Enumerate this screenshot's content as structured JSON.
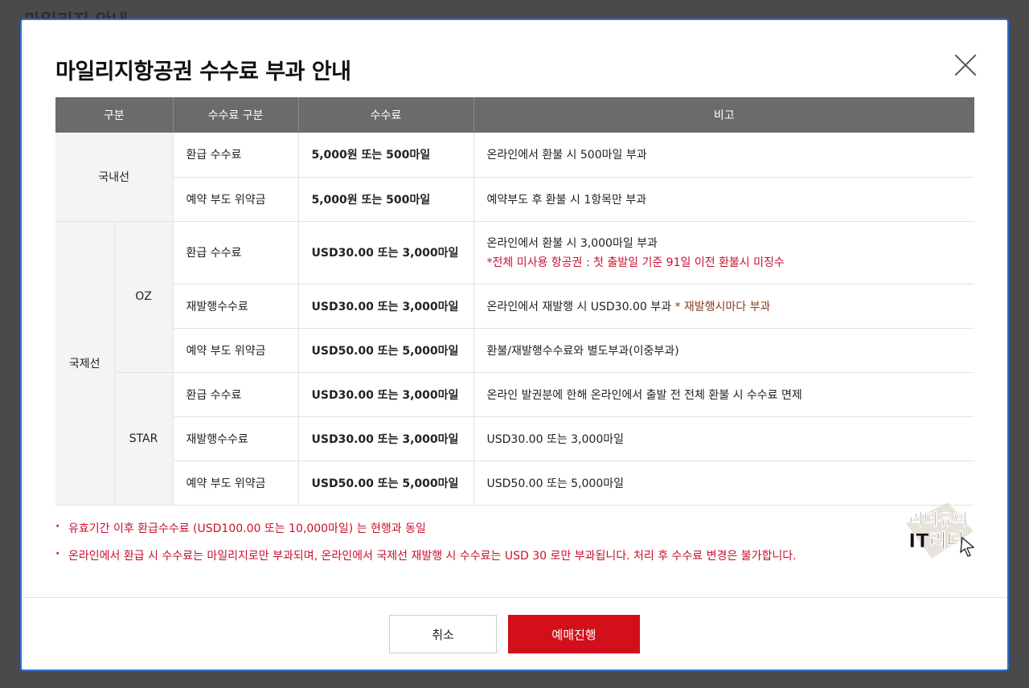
{
  "background": {
    "title": "마일리지 안내"
  },
  "modal": {
    "title": "마일리지항공권 수수료 부과 안내",
    "close_icon": "close-icon"
  },
  "table": {
    "headers": [
      "구분",
      "수수료 구분",
      "수수료",
      "비고"
    ],
    "domestic": {
      "label": "국내선",
      "rows": [
        {
          "type": "환급 수수료",
          "fee": "5,000원 또는 500마일",
          "note": "온라인에서 환불 시 500마일 부과"
        },
        {
          "type": "예약 부도 위약금",
          "fee": "5,000원 또는 500마일",
          "note": "예약부도 후 환불 시 1항목만 부과"
        }
      ]
    },
    "international": {
      "label": "국제선",
      "oz": {
        "label": "OZ",
        "rows": [
          {
            "type": "환급 수수료",
            "fee": "USD30.00 또는 3,000마일",
            "note": "온라인에서 환불 시 3,000마일 부과",
            "note_red": "*전체 미사용 항공권 : 첫 출발일 기준 91일 이전 환불시 미징수"
          },
          {
            "type": "재발행수수료",
            "fee": "USD30.00 또는 3,000마일",
            "note": "온라인에서 재발행 시 USD30.00 부과",
            "note_brown": "* 재발행시마다 부과"
          },
          {
            "type": "예약 부도 위약금",
            "fee": "USD50.00 또는 5,000마일",
            "note": "환불/재발행수수료와 별도부과(이중부과)"
          }
        ]
      },
      "star": {
        "label": "STAR",
        "rows": [
          {
            "type": "환급 수수료",
            "fee": "USD30.00 또는 3,000마일",
            "note": "온라인 발권분에 한해 온라인에서 출발 전 전체 환불 시 수수료 면제"
          },
          {
            "type": "재발행수수료",
            "fee": "USD30.00 또는 3,000마일",
            "note": "USD30.00 또는 3,000마일"
          },
          {
            "type": "예약 부도 위약금",
            "fee": "USD50.00 또는 5,000마일",
            "note": "USD50.00 또는 5,000마일"
          }
        ]
      }
    }
  },
  "notes": [
    "유효기간 이후 환급수수료 (USD100.00 또는 10,000마일) 는 현행과 동일",
    "온라인에서 환급 시 수수료는 마일리지로만 부과되며, 온라인에서 국제선 재발행 시 수수료는 USD 30 로만 부과됩니다. 처리 후 수수료 변경은 불가합니다."
  ],
  "watermark": {
    "line1": "리더유의",
    "line2": "IT리더"
  },
  "buttons": {
    "cancel": "취소",
    "proceed": "예매진행"
  },
  "colors": {
    "accent": "#d30f1b",
    "header_bg": "#6b6b6b",
    "note_red": "#c8102e",
    "modal_border": "#2f6fd6"
  }
}
